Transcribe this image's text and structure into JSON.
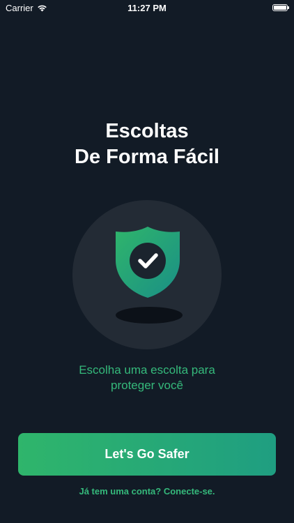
{
  "status_bar": {
    "carrier": "Carrier",
    "time": "11:27 PM",
    "icons": [
      "wifi-icon",
      "battery-icon"
    ]
  },
  "hero": {
    "title_line1": "Escoltas",
    "title_line2": "De Forma Fácil",
    "illustration_icon": "shield-check-icon"
  },
  "subtitle": {
    "line1": "Escolha uma escolta para",
    "line2": "proteger você"
  },
  "actions": {
    "primary_label": "Let's Go Safer",
    "login_link": "Já tem uma conta? Conecte-se."
  },
  "colors": {
    "background": "#121b26",
    "accent_green": "#35b97b",
    "button_gradient_start": "#2fb56b",
    "button_gradient_end": "#1f9e81",
    "circle": "#232b35"
  }
}
